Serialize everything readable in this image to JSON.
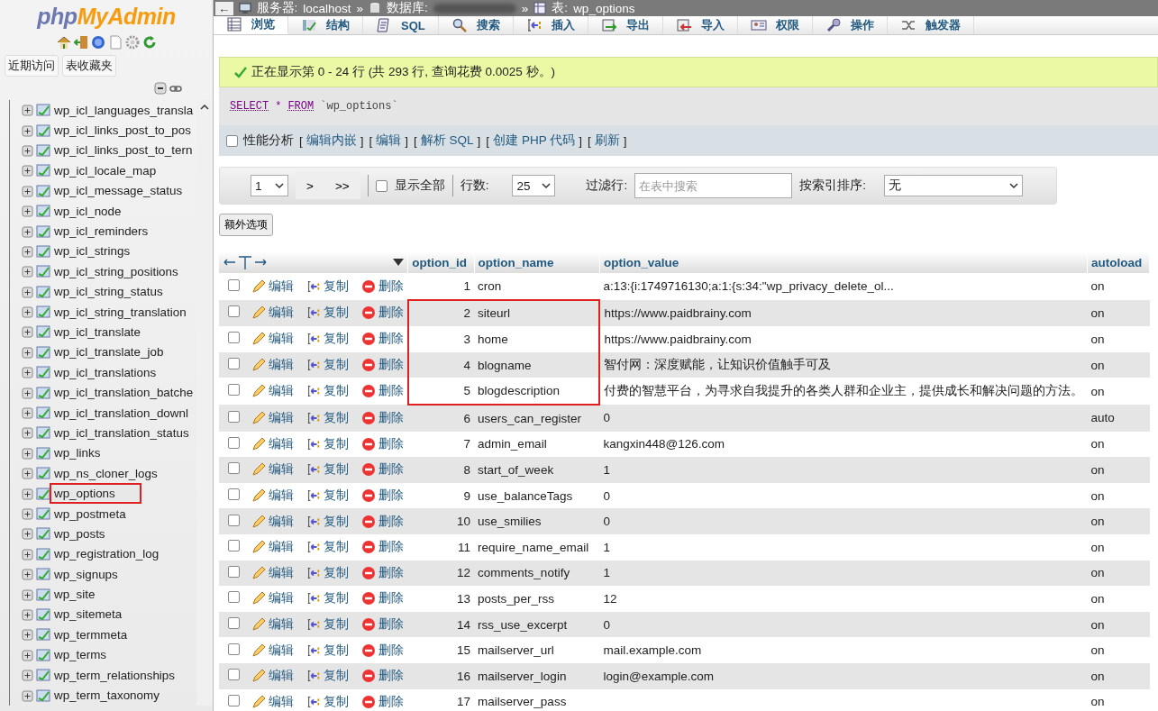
{
  "sidebar": {
    "logo_left": "php",
    "logo_right": "MyAdmin",
    "buttons": [
      "近期访问",
      "表收藏夹"
    ],
    "tree": [
      {
        "name": "wp_icl_languages_transla",
        "highlighted": false
      },
      {
        "name": "wp_icl_links_post_to_pos",
        "highlighted": false
      },
      {
        "name": "wp_icl_links_post_to_tern",
        "highlighted": false
      },
      {
        "name": "wp_icl_locale_map",
        "highlighted": false
      },
      {
        "name": "wp_icl_message_status",
        "highlighted": false
      },
      {
        "name": "wp_icl_node",
        "highlighted": false
      },
      {
        "name": "wp_icl_reminders",
        "highlighted": false
      },
      {
        "name": "wp_icl_strings",
        "highlighted": false
      },
      {
        "name": "wp_icl_string_positions",
        "highlighted": false
      },
      {
        "name": "wp_icl_string_status",
        "highlighted": false
      },
      {
        "name": "wp_icl_string_translation",
        "highlighted": false
      },
      {
        "name": "wp_icl_translate",
        "highlighted": false
      },
      {
        "name": "wp_icl_translate_job",
        "highlighted": false
      },
      {
        "name": "wp_icl_translations",
        "highlighted": false
      },
      {
        "name": "wp_icl_translation_batche",
        "highlighted": false
      },
      {
        "name": "wp_icl_translation_downl",
        "highlighted": false
      },
      {
        "name": "wp_icl_translation_status",
        "highlighted": false
      },
      {
        "name": "wp_links",
        "highlighted": false
      },
      {
        "name": "wp_ns_cloner_logs",
        "highlighted": false
      },
      {
        "name": "wp_options",
        "highlighted": true
      },
      {
        "name": "wp_postmeta",
        "highlighted": false
      },
      {
        "name": "wp_posts",
        "highlighted": false
      },
      {
        "name": "wp_registration_log",
        "highlighted": false
      },
      {
        "name": "wp_signups",
        "highlighted": false
      },
      {
        "name": "wp_site",
        "highlighted": false
      },
      {
        "name": "wp_sitemeta",
        "highlighted": false
      },
      {
        "name": "wp_termmeta",
        "highlighted": false
      },
      {
        "name": "wp_terms",
        "highlighted": false
      },
      {
        "name": "wp_term_relationships",
        "highlighted": false
      },
      {
        "name": "wp_term_taxonomy",
        "highlighted": false
      }
    ]
  },
  "breadcrumb": {
    "back": "←",
    "server_label": "服务器:",
    "server": "localhost",
    "sep1": "»",
    "db_label": "数据库:",
    "sep2": "»",
    "table_label": "表:",
    "table": "wp_options"
  },
  "tabs": [
    {
      "kind": "browse",
      "label": "浏览",
      "selected": true
    },
    {
      "kind": "structure",
      "label": "结构",
      "selected": false
    },
    {
      "kind": "sql",
      "label": "SQL",
      "selected": false
    },
    {
      "kind": "search",
      "label": "搜索",
      "selected": false
    },
    {
      "kind": "insert",
      "label": "插入",
      "selected": false
    },
    {
      "kind": "export",
      "label": "导出",
      "selected": false
    },
    {
      "kind": "import",
      "label": "导入",
      "selected": false
    },
    {
      "kind": "privileges",
      "label": "权限",
      "selected": false
    },
    {
      "kind": "operations",
      "label": "操作",
      "selected": false
    },
    {
      "kind": "triggers",
      "label": "触发器",
      "selected": false
    }
  ],
  "success_message": "正在显示第 0 - 24 行 (共 293 行, 查询花费 0.0025 秒。)",
  "query": {
    "keyword1": "SELECT",
    "star": "*",
    "keyword2": "FROM",
    "table": "`wp_options`"
  },
  "query_tools": {
    "profiling_label": "性能分析",
    "profiling_checked": false,
    "links": [
      {
        "open": "[",
        "label": "编辑内嵌",
        "close": "]"
      },
      {
        "open": "[",
        "label": "编辑",
        "close": "]"
      },
      {
        "open": "[",
        "label": "解析 SQL",
        "close": "]"
      },
      {
        "open": "[",
        "label": "创建 PHP 代码",
        "close": "]"
      },
      {
        "open": "[",
        "label": "刷新",
        "close": "]"
      }
    ]
  },
  "navigation": {
    "page": "1",
    "next": ">",
    "last": ">>",
    "show_all_label": "显示全部",
    "show_all_checked": false,
    "rows_label": "行数:",
    "rows": "25",
    "filter_label": "过滤行:",
    "filter_placeholder": "在表中搜索",
    "sort_label": "按索引排序:",
    "sort": "无"
  },
  "extra_options": "额外选项",
  "table": {
    "columns": [
      "option_id",
      "option_name",
      "option_value",
      "autoload"
    ],
    "rows": [
      {
        "id": "1",
        "name": "cron",
        "value": "a:13:{i:1749716130;a:1:{s:34:\"wp_privacy_delete_ol...",
        "autoload": "on",
        "highlighted": false,
        "edit": "编辑",
        "copy": "复制",
        "delete": "删除",
        "checked": false
      },
      {
        "id": "2",
        "name": "siteurl",
        "value": "https://www.paidbrainy.com",
        "autoload": "on",
        "highlighted": true,
        "edit": "编辑",
        "copy": "复制",
        "delete": "删除",
        "checked": false
      },
      {
        "id": "3",
        "name": "home",
        "value": "https://www.paidbrainy.com",
        "autoload": "on",
        "highlighted": true,
        "edit": "编辑",
        "copy": "复制",
        "delete": "删除",
        "checked": false
      },
      {
        "id": "4",
        "name": "blogname",
        "value": "智付网：深度赋能，让知识价值触手可及",
        "autoload": "on",
        "highlighted": true,
        "edit": "编辑",
        "copy": "复制",
        "delete": "删除",
        "checked": false
      },
      {
        "id": "5",
        "name": "blogdescription",
        "value": "付费的智慧平台，为寻求自我提升的各类人群和企业主，提供成长和解决问题的方法。",
        "autoload": "on",
        "highlighted": true,
        "edit": "编辑",
        "copy": "复制",
        "delete": "删除",
        "checked": false
      },
      {
        "id": "6",
        "name": "users_can_register",
        "value": "0",
        "autoload": "auto",
        "highlighted": false,
        "edit": "编辑",
        "copy": "复制",
        "delete": "删除",
        "checked": false
      },
      {
        "id": "7",
        "name": "admin_email",
        "value": "kangxin448@126.com",
        "autoload": "on",
        "highlighted": false,
        "edit": "编辑",
        "copy": "复制",
        "delete": "删除",
        "checked": false
      },
      {
        "id": "8",
        "name": "start_of_week",
        "value": "1",
        "autoload": "on",
        "highlighted": false,
        "edit": "编辑",
        "copy": "复制",
        "delete": "删除",
        "checked": false
      },
      {
        "id": "9",
        "name": "use_balanceTags",
        "value": "0",
        "autoload": "on",
        "highlighted": false,
        "edit": "编辑",
        "copy": "复制",
        "delete": "删除",
        "checked": false
      },
      {
        "id": "10",
        "name": "use_smilies",
        "value": "0",
        "autoload": "on",
        "highlighted": false,
        "edit": "编辑",
        "copy": "复制",
        "delete": "删除",
        "checked": false
      },
      {
        "id": "11",
        "name": "require_name_email",
        "value": "1",
        "autoload": "on",
        "highlighted": false,
        "edit": "编辑",
        "copy": "复制",
        "delete": "删除",
        "checked": false
      },
      {
        "id": "12",
        "name": "comments_notify",
        "value": "1",
        "autoload": "on",
        "highlighted": false,
        "edit": "编辑",
        "copy": "复制",
        "delete": "删除",
        "checked": false
      },
      {
        "id": "13",
        "name": "posts_per_rss",
        "value": "12",
        "autoload": "on",
        "highlighted": false,
        "edit": "编辑",
        "copy": "复制",
        "delete": "删除",
        "checked": false
      },
      {
        "id": "14",
        "name": "rss_use_excerpt",
        "value": "0",
        "autoload": "on",
        "highlighted": false,
        "edit": "编辑",
        "copy": "复制",
        "delete": "删除",
        "checked": false
      },
      {
        "id": "15",
        "name": "mailserver_url",
        "value": "mail.example.com",
        "autoload": "on",
        "highlighted": false,
        "edit": "编辑",
        "copy": "复制",
        "delete": "删除",
        "checked": false
      },
      {
        "id": "16",
        "name": "mailserver_login",
        "value": "login@example.com",
        "autoload": "on",
        "highlighted": false,
        "edit": "编辑",
        "copy": "复制",
        "delete": "删除",
        "checked": false
      },
      {
        "id": "17",
        "name": "mailserver_pass",
        "autoload": "on",
        "highlighted": false,
        "edit": "编辑",
        "copy": "复制",
        "delete": "删除",
        "checked": false
      }
    ]
  }
}
